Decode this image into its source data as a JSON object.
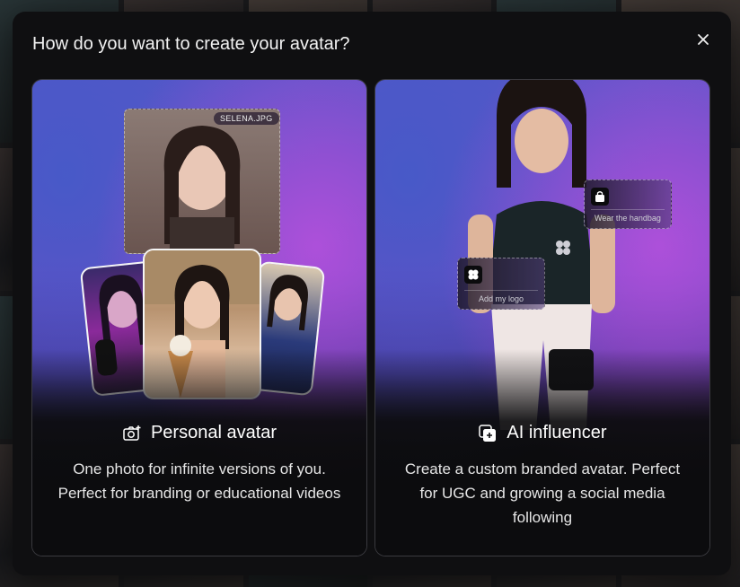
{
  "modal": {
    "title": "How do you want to create your avatar?",
    "close_icon": "close-icon"
  },
  "cards": [
    {
      "id": "personal",
      "title": "Personal avatar",
      "icon": "camera-plus-icon",
      "description": "One photo for infinite versions of you. Perfect for branding or educational videos",
      "file_tag": "SELENA.JPG"
    },
    {
      "id": "influencer",
      "title": "AI influencer",
      "icon": "stack-plus-icon",
      "description": "Create a custom branded avatar. Perfect for UGC and growing a social media following",
      "tags": [
        {
          "label": "Wear the handbag",
          "icon": "handbag-icon"
        },
        {
          "label": "Add my logo",
          "icon": "logo-icon"
        }
      ]
    }
  ],
  "colors": {
    "modal_bg": "#0f0f11",
    "accent_purple": "#6d4bc4",
    "accent_blue": "#5a55c8"
  }
}
